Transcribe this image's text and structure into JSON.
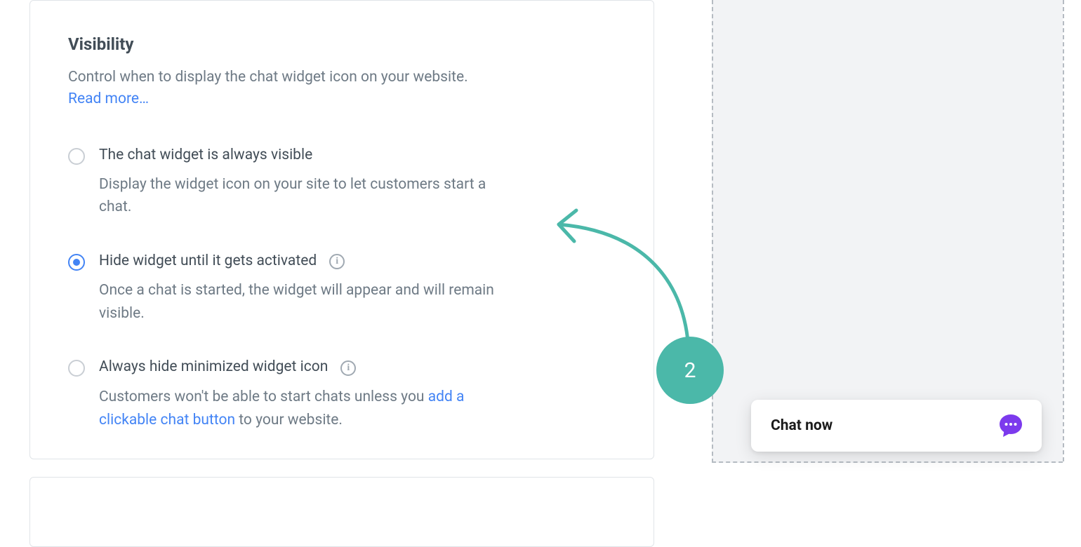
{
  "section": {
    "title": "Visibility",
    "description": "Control when to display the chat widget icon on your website.",
    "read_more": "Read more…"
  },
  "options": [
    {
      "label": "The chat widget is always visible",
      "desc": "Display the widget icon on your site to let customers start a chat.",
      "selected": false,
      "info": false
    },
    {
      "label": "Hide widget until it gets activated",
      "desc": "Once a chat is started, the widget will appear and will remain visible.",
      "selected": true,
      "info": true
    },
    {
      "label": "Always hide minimized widget icon",
      "desc_pre": "Customers won't be able to start chats unless you ",
      "link": "add a clickable chat button",
      "desc_post": " to your website.",
      "selected": false,
      "info": true
    }
  ],
  "step": {
    "number": "2"
  },
  "chat": {
    "label": "Chat now"
  },
  "colors": {
    "accent": "#4bb8a9",
    "link": "#4384f5",
    "chat_icon": "#7c3aed"
  }
}
